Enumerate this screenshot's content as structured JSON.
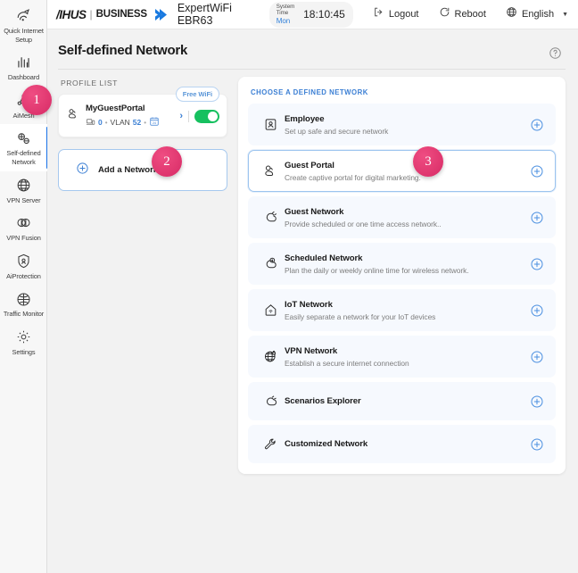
{
  "topbar": {
    "brand_asus": "/IHUS",
    "brand_sep": "|",
    "brand_business": "BUSINESS",
    "model": "ExpertWiFi EBR63",
    "system_time_label": "System Time",
    "system_time_day": "Mon",
    "system_time_clock": "18:10:45",
    "logout_label": "Logout",
    "reboot_label": "Reboot",
    "language_label": "English"
  },
  "sidebar": {
    "items": [
      {
        "label": "Quick Internet Setup",
        "icon": "quick-internet-setup-icon",
        "active": false
      },
      {
        "label": "Dashboard",
        "icon": "dashboard-icon",
        "active": false
      },
      {
        "label": "AiMesh",
        "icon": "aimesh-icon",
        "active": false
      },
      {
        "label": "Self-defined Network",
        "icon": "self-defined-network-icon",
        "active": true
      },
      {
        "label": "VPN Server",
        "icon": "vpn-server-icon",
        "active": false
      },
      {
        "label": "VPN Fusion",
        "icon": "vpn-fusion-icon",
        "active": false
      },
      {
        "label": "AiProtection",
        "icon": "aiprotection-icon",
        "active": false
      },
      {
        "label": "Traffic Monitor",
        "icon": "traffic-monitor-icon",
        "active": false
      },
      {
        "label": "Settings",
        "icon": "settings-gear-icon",
        "active": false
      }
    ]
  },
  "page": {
    "title": "Self-defined Network",
    "help_icon": "help-question-icon"
  },
  "profile_list": {
    "caption": "PROFILE LIST",
    "profile": {
      "free_badge": "Free WiFi",
      "name": "MyGuestPortal",
      "client_count": "0",
      "dot": "•",
      "vlan_label": "VLAN",
      "vlan_id": "52",
      "schedule_icon": "schedule-24h-icon",
      "arrow": "›",
      "toggle_on": true
    },
    "add_network_label": "Add a Network"
  },
  "choose_panel": {
    "caption": "CHOOSE A DEFINED NETWORK",
    "rows": [
      {
        "title": "Employee",
        "desc": "Set up safe and secure network",
        "icon": "employee-badge-icon",
        "selected": false
      },
      {
        "title": "Guest Portal",
        "desc": "Create captive portal for digital marketing.",
        "icon": "guest-portal-icon",
        "selected": true
      },
      {
        "title": "Guest Network",
        "desc": "Provide scheduled or one time access network..",
        "icon": "guest-network-icon",
        "selected": false
      },
      {
        "title": "Scheduled Network",
        "desc": "Plan the daily or weekly online time for wireless network.",
        "icon": "scheduled-network-icon",
        "selected": false
      },
      {
        "title": "IoT Network",
        "desc": "Easily separate a network for your IoT devices",
        "icon": "iot-network-icon",
        "selected": false
      },
      {
        "title": "VPN Network",
        "desc": "Establish a secure internet connection",
        "icon": "vpn-network-icon",
        "selected": false
      },
      {
        "title": "Scenarios Explorer",
        "desc": "",
        "icon": "scenarios-explorer-icon",
        "selected": false
      },
      {
        "title": "Customized Network",
        "desc": "",
        "icon": "customized-network-icon",
        "selected": false
      }
    ]
  },
  "step_badges": [
    {
      "number": "1"
    },
    {
      "number": "2"
    },
    {
      "number": "3"
    }
  ],
  "colors": {
    "accent_blue": "#3b7fd4",
    "badge_pink": "#e23a72",
    "toggle_green": "#16c05f",
    "page_bg": "#f2f2f2"
  }
}
